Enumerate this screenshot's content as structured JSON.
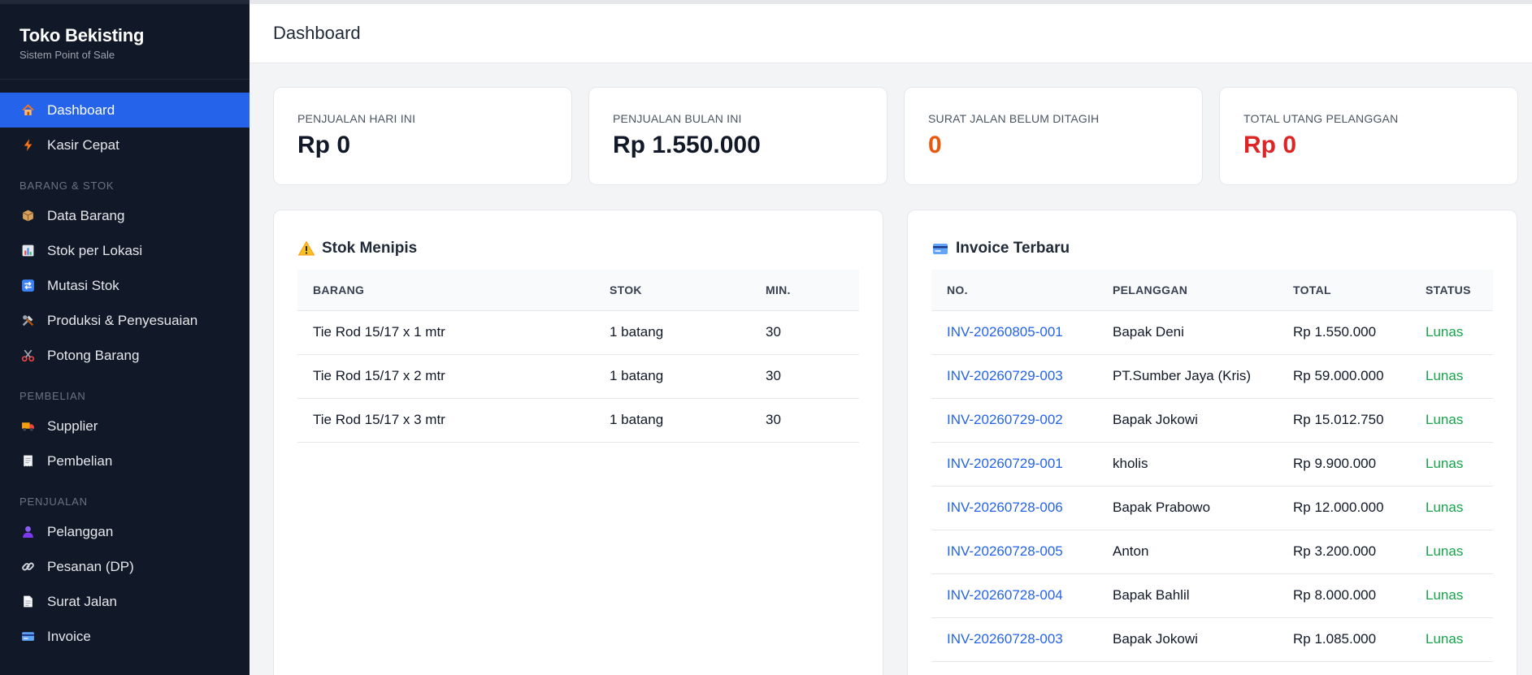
{
  "brand": {
    "title": "Toko Bekisting",
    "subtitle": "Sistem Point of Sale"
  },
  "sidebar": {
    "items": [
      {
        "label": "Dashboard",
        "icon": "house-icon"
      },
      {
        "label": "Kasir Cepat",
        "icon": "lightning-icon"
      }
    ],
    "sections": [
      {
        "title": "BARANG & STOK",
        "items": [
          {
            "label": "Data Barang",
            "icon": "box-icon"
          },
          {
            "label": "Stok per Lokasi",
            "icon": "bar-chart-icon"
          },
          {
            "label": "Mutasi Stok",
            "icon": "transfer-icon"
          },
          {
            "label": "Produksi & Penyesuaian",
            "icon": "tools-icon"
          },
          {
            "label": "Potong Barang",
            "icon": "scissors-icon"
          }
        ]
      },
      {
        "title": "PEMBELIAN",
        "items": [
          {
            "label": "Supplier",
            "icon": "truck-icon"
          },
          {
            "label": "Pembelian",
            "icon": "receipt-icon"
          }
        ]
      },
      {
        "title": "PENJUALAN",
        "items": [
          {
            "label": "Pelanggan",
            "icon": "person-icon"
          },
          {
            "label": "Pesanan (DP)",
            "icon": "link-icon"
          },
          {
            "label": "Surat Jalan",
            "icon": "document-icon"
          },
          {
            "label": "Invoice",
            "icon": "credit-card-icon"
          }
        ]
      }
    ]
  },
  "header": {
    "title": "Dashboard"
  },
  "stats": [
    {
      "label": "PENJUALAN HARI INI",
      "value": "Rp 0",
      "color": "#111827"
    },
    {
      "label": "PENJUALAN BULAN INI",
      "value": "Rp 1.550.000",
      "color": "#111827"
    },
    {
      "label": "SURAT JALAN BELUM DITAGIH",
      "value": "0",
      "color": "#ea580c"
    },
    {
      "label": "TOTAL UTANG PELANGGAN",
      "value": "Rp 0",
      "color": "#dc2626"
    }
  ],
  "low_stock": {
    "title": "Stok Menipis",
    "icon": "warning-icon",
    "columns": [
      "BARANG",
      "STOK",
      "MIN."
    ],
    "rows": [
      {
        "barang": "Tie Rod 15/17 x 1 mtr",
        "stok": "1 batang",
        "min": "30"
      },
      {
        "barang": "Tie Rod 15/17 x 2 mtr",
        "stok": "1 batang",
        "min": "30"
      },
      {
        "barang": "Tie Rod 15/17 x 3 mtr",
        "stok": "1 batang",
        "min": "30"
      }
    ]
  },
  "invoices": {
    "title": "Invoice Terbaru",
    "icon": "credit-card-icon",
    "columns": [
      "NO.",
      "PELANGGAN",
      "TOTAL",
      "STATUS"
    ],
    "rows": [
      {
        "no": "INV-20260805-001",
        "pelanggan": "Bapak Deni",
        "total": "Rp 1.550.000",
        "status": "Lunas"
      },
      {
        "no": "INV-20260729-003",
        "pelanggan": "PT.Sumber Jaya (Kris)",
        "total": "Rp 59.000.000",
        "status": "Lunas"
      },
      {
        "no": "INV-20260729-002",
        "pelanggan": "Bapak Jokowi",
        "total": "Rp 15.012.750",
        "status": "Lunas"
      },
      {
        "no": "INV-20260729-001",
        "pelanggan": "kholis",
        "total": "Rp 9.900.000",
        "status": "Lunas"
      },
      {
        "no": "INV-20260728-006",
        "pelanggan": "Bapak Prabowo",
        "total": "Rp 12.000.000",
        "status": "Lunas"
      },
      {
        "no": "INV-20260728-005",
        "pelanggan": "Anton",
        "total": "Rp 3.200.000",
        "status": "Lunas"
      },
      {
        "no": "INV-20260728-004",
        "pelanggan": "Bapak Bahlil",
        "total": "Rp 8.000.000",
        "status": "Lunas"
      },
      {
        "no": "INV-20260728-003",
        "pelanggan": "Bapak Jokowi",
        "total": "Rp 1.085.000",
        "status": "Lunas"
      }
    ]
  }
}
